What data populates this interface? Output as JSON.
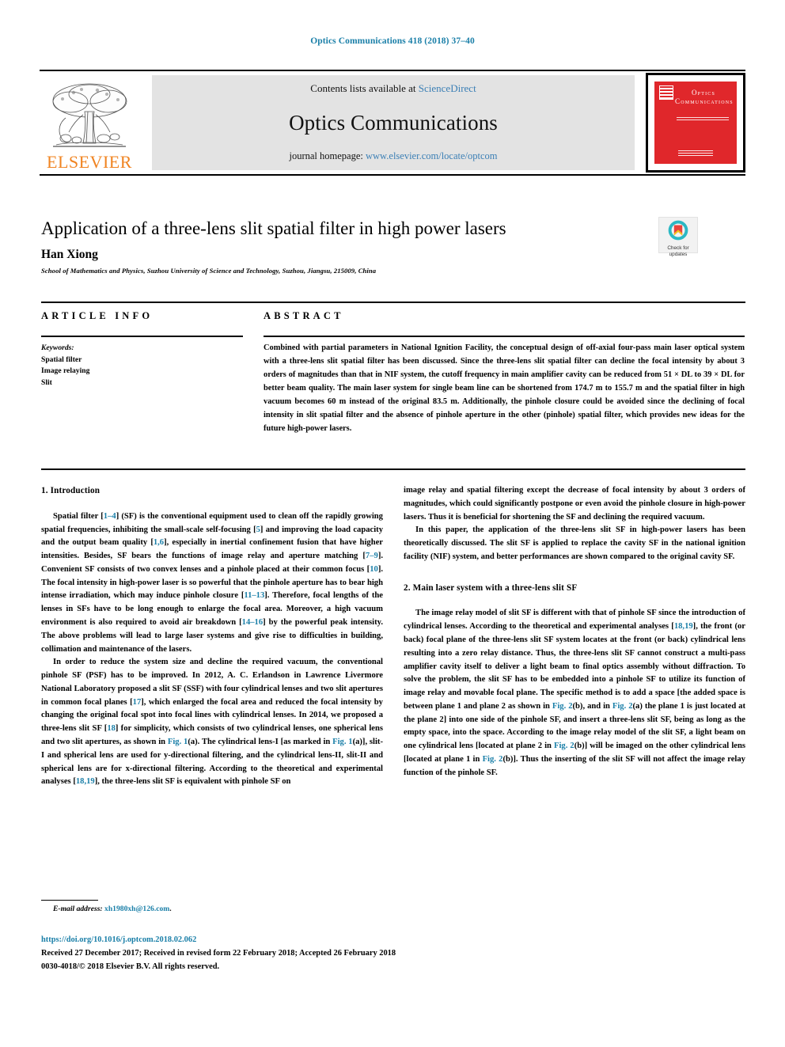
{
  "header": {
    "issue_line": "Optics Communications 418 (2018) 37–40",
    "contents_prefix": "Contents lists available at ",
    "contents_link": "ScienceDirect",
    "journal_title": "Optics Communications",
    "homepage_prefix": "journal homepage: ",
    "homepage_link": "www.elsevier.com/locate/optcom",
    "publisher_wordmark": "ELSEVIER",
    "cover_title_line1": "Optics",
    "cover_title_line2": "Communications"
  },
  "article": {
    "title": "Application of a three-lens slit spatial filter in high power lasers",
    "author": "Han Xiong",
    "affiliation": "School of Mathematics and Physics, Suzhou University of Science and Technology, Suzhou, Jiangsu, 215009, China",
    "crossmark_line1": "Check for",
    "crossmark_line2": "updates"
  },
  "info": {
    "heading": "ARTICLE INFO",
    "keywords_label": "Keywords:",
    "keywords": [
      "Spatial filter",
      "Image relaying",
      "Slit"
    ]
  },
  "abstract": {
    "heading": "ABSTRACT",
    "text": "Combined with partial parameters in National Ignition Facility, the conceptual design of off-axial four-pass main laser optical system with a three-lens slit spatial filter has been discussed. Since the three-lens slit spatial filter can decline the focal intensity by about 3 orders of magnitudes than that in NIF system, the cutoff frequency in main amplifier cavity can be reduced from 51 × DL to 39 × DL for better beam quality. The main laser system for single beam line can be shortened from 174.7 m to 155.7 m and the spatial filter in high vacuum becomes 60 m instead of the original 83.5 m. Additionally, the pinhole closure could be avoided since the declining of focal intensity in slit spatial filter and the absence of pinhole aperture in the other (pinhole) spatial filter, which provides new ideas for the future high-power lasers."
  },
  "body": {
    "section1_title": "1. Introduction",
    "section2_title": "2. Main laser system with a three-lens slit SF",
    "left_paragraphs": [
      {
        "segments": [
          {
            "t": "Spatial filter ["
          },
          {
            "t": "1–4",
            "link": true
          },
          {
            "t": "] (SF) is the conventional equipment used to clean off the rapidly growing spatial frequencies, inhibiting the small-scale self-focusing ["
          },
          {
            "t": "5",
            "link": true
          },
          {
            "t": "] and improving the load capacity and the output beam quality ["
          },
          {
            "t": "1,6",
            "link": true
          },
          {
            "t": "], especially in inertial confinement fusion that have higher intensities. Besides, SF bears the functions of image relay and aperture matching ["
          },
          {
            "t": "7–9",
            "link": true
          },
          {
            "t": "]. Convenient SF consists of two convex lenses and a pinhole placed at their common focus ["
          },
          {
            "t": "10",
            "link": true
          },
          {
            "t": "]. The focal intensity in high-power laser is so powerful that the pinhole aperture has to bear high intense irradiation, which may induce pinhole closure ["
          },
          {
            "t": "11–13",
            "link": true
          },
          {
            "t": "]. Therefore, focal lengths of the lenses in SFs have to be long enough to enlarge the focal area. Moreover, a high vacuum environment is also required to avoid air breakdown ["
          },
          {
            "t": "14–16",
            "link": true
          },
          {
            "t": "] by the powerful peak intensity. The above problems will lead to large laser systems and give rise to difficulties in building, collimation and maintenance of the lasers."
          }
        ]
      },
      {
        "segments": [
          {
            "t": "In order to reduce the system size and decline the required vacuum, the conventional pinhole SF (PSF) has to be improved. In 2012, A. C. Erlandson in Lawrence Livermore National Laboratory proposed a slit SF (SSF) with four cylindrical lenses and two slit apertures in common focal planes ["
          },
          {
            "t": "17",
            "link": true
          },
          {
            "t": "], which enlarged the focal area and reduced the focal intensity by changing the original focal spot into focal lines with cylindrical lenses. In 2014, we proposed a three-lens slit SF ["
          },
          {
            "t": "18",
            "link": true
          },
          {
            "t": "] for simplicity, which consists of two cylindrical lenses, one spherical lens and two slit apertures, as shown in "
          },
          {
            "t": "Fig. 1",
            "link": true
          },
          {
            "t": "(a). The cylindrical lens-I [as marked in "
          },
          {
            "t": "Fig. 1",
            "link": true
          },
          {
            "t": "(a)], slit-I and spherical lens are used for y-directional filtering, and the cylindrical lens-II, slit-II and spherical lens are for x-directional filtering. According to the theoretical and experimental analyses ["
          },
          {
            "t": "18,19",
            "link": true
          },
          {
            "t": "], the three-lens slit SF is equivalent with pinhole SF on"
          }
        ]
      }
    ],
    "right_paragraphs": [
      {
        "no_indent": true,
        "segments": [
          {
            "t": "image relay and spatial filtering except the decrease of focal intensity by about 3 orders of magnitudes, which could significantly postpone or even avoid the pinhole closure in high-power lasers. Thus it is beneficial for shortening the SF and declining the required vacuum."
          }
        ]
      },
      {
        "segments": [
          {
            "t": "In this paper, the application of the three-lens slit SF in high-power lasers has been theoretically discussed. The slit SF is applied to replace the cavity SF in the national ignition facility (NIF) system, and better performances are shown compared to the original cavity SF."
          }
        ]
      }
    ],
    "right_paragraphs_2": [
      {
        "segments": [
          {
            "t": "The image relay model of slit SF is different with that of pinhole SF since the introduction of cylindrical lenses. According to the theoretical and experimental analyses ["
          },
          {
            "t": "18,19",
            "link": true
          },
          {
            "t": "], the front (or back) focal plane of the three-lens slit SF system locates at the front (or back) cylindrical lens resulting into a zero relay distance. Thus, the three-lens slit SF cannot construct a multi-pass amplifier cavity itself to deliver a light beam to final optics assembly without diffraction. To solve the problem, the slit SF has to be embedded into a pinhole SF to utilize its function of image relay and movable focal plane. The specific method is to add a space [the added space is between plane 1 and plane 2 as shown in "
          },
          {
            "t": "Fig. 2",
            "link": true
          },
          {
            "t": "(b), and in "
          },
          {
            "t": "Fig. 2",
            "link": true
          },
          {
            "t": "(a) the plane 1 is just located at the plane 2] into one side of the pinhole SF, and insert a three-lens slit SF, being as long as the empty space, into the space. According to the image relay model of the slit SF, a light beam on one cylindrical lens [located at plane 2 in "
          },
          {
            "t": "Fig. 2",
            "link": true
          },
          {
            "t": "(b)] will be imaged on the other cylindrical lens [located at plane 1 in "
          },
          {
            "t": "Fig. 2",
            "link": true
          },
          {
            "t": "(b)]. Thus the inserting of the slit SF will not affect the image relay function of the pinhole SF."
          }
        ]
      }
    ]
  },
  "footer": {
    "email_label": "E-mail address:",
    "email": "xh1980xh@126.com",
    "email_suffix": ".",
    "doi": "https://doi.org/10.1016/j.optcom.2018.02.062",
    "received": "Received 27 December 2017; Received in revised form 22 February 2018; Accepted 26 February 2018",
    "copyright": "0030-4018/© 2018 Elsevier B.V. All rights reserved."
  },
  "colors": {
    "link": "#1a7fa8",
    "masthead_link": "#3b7fb5",
    "elsevier_orange": "#f08422",
    "cover_red": "#e0272b",
    "crossmark_teal": "#2bb8c4",
    "crossmark_red": "#e8443d",
    "crossmark_yellow": "#f5c518"
  }
}
